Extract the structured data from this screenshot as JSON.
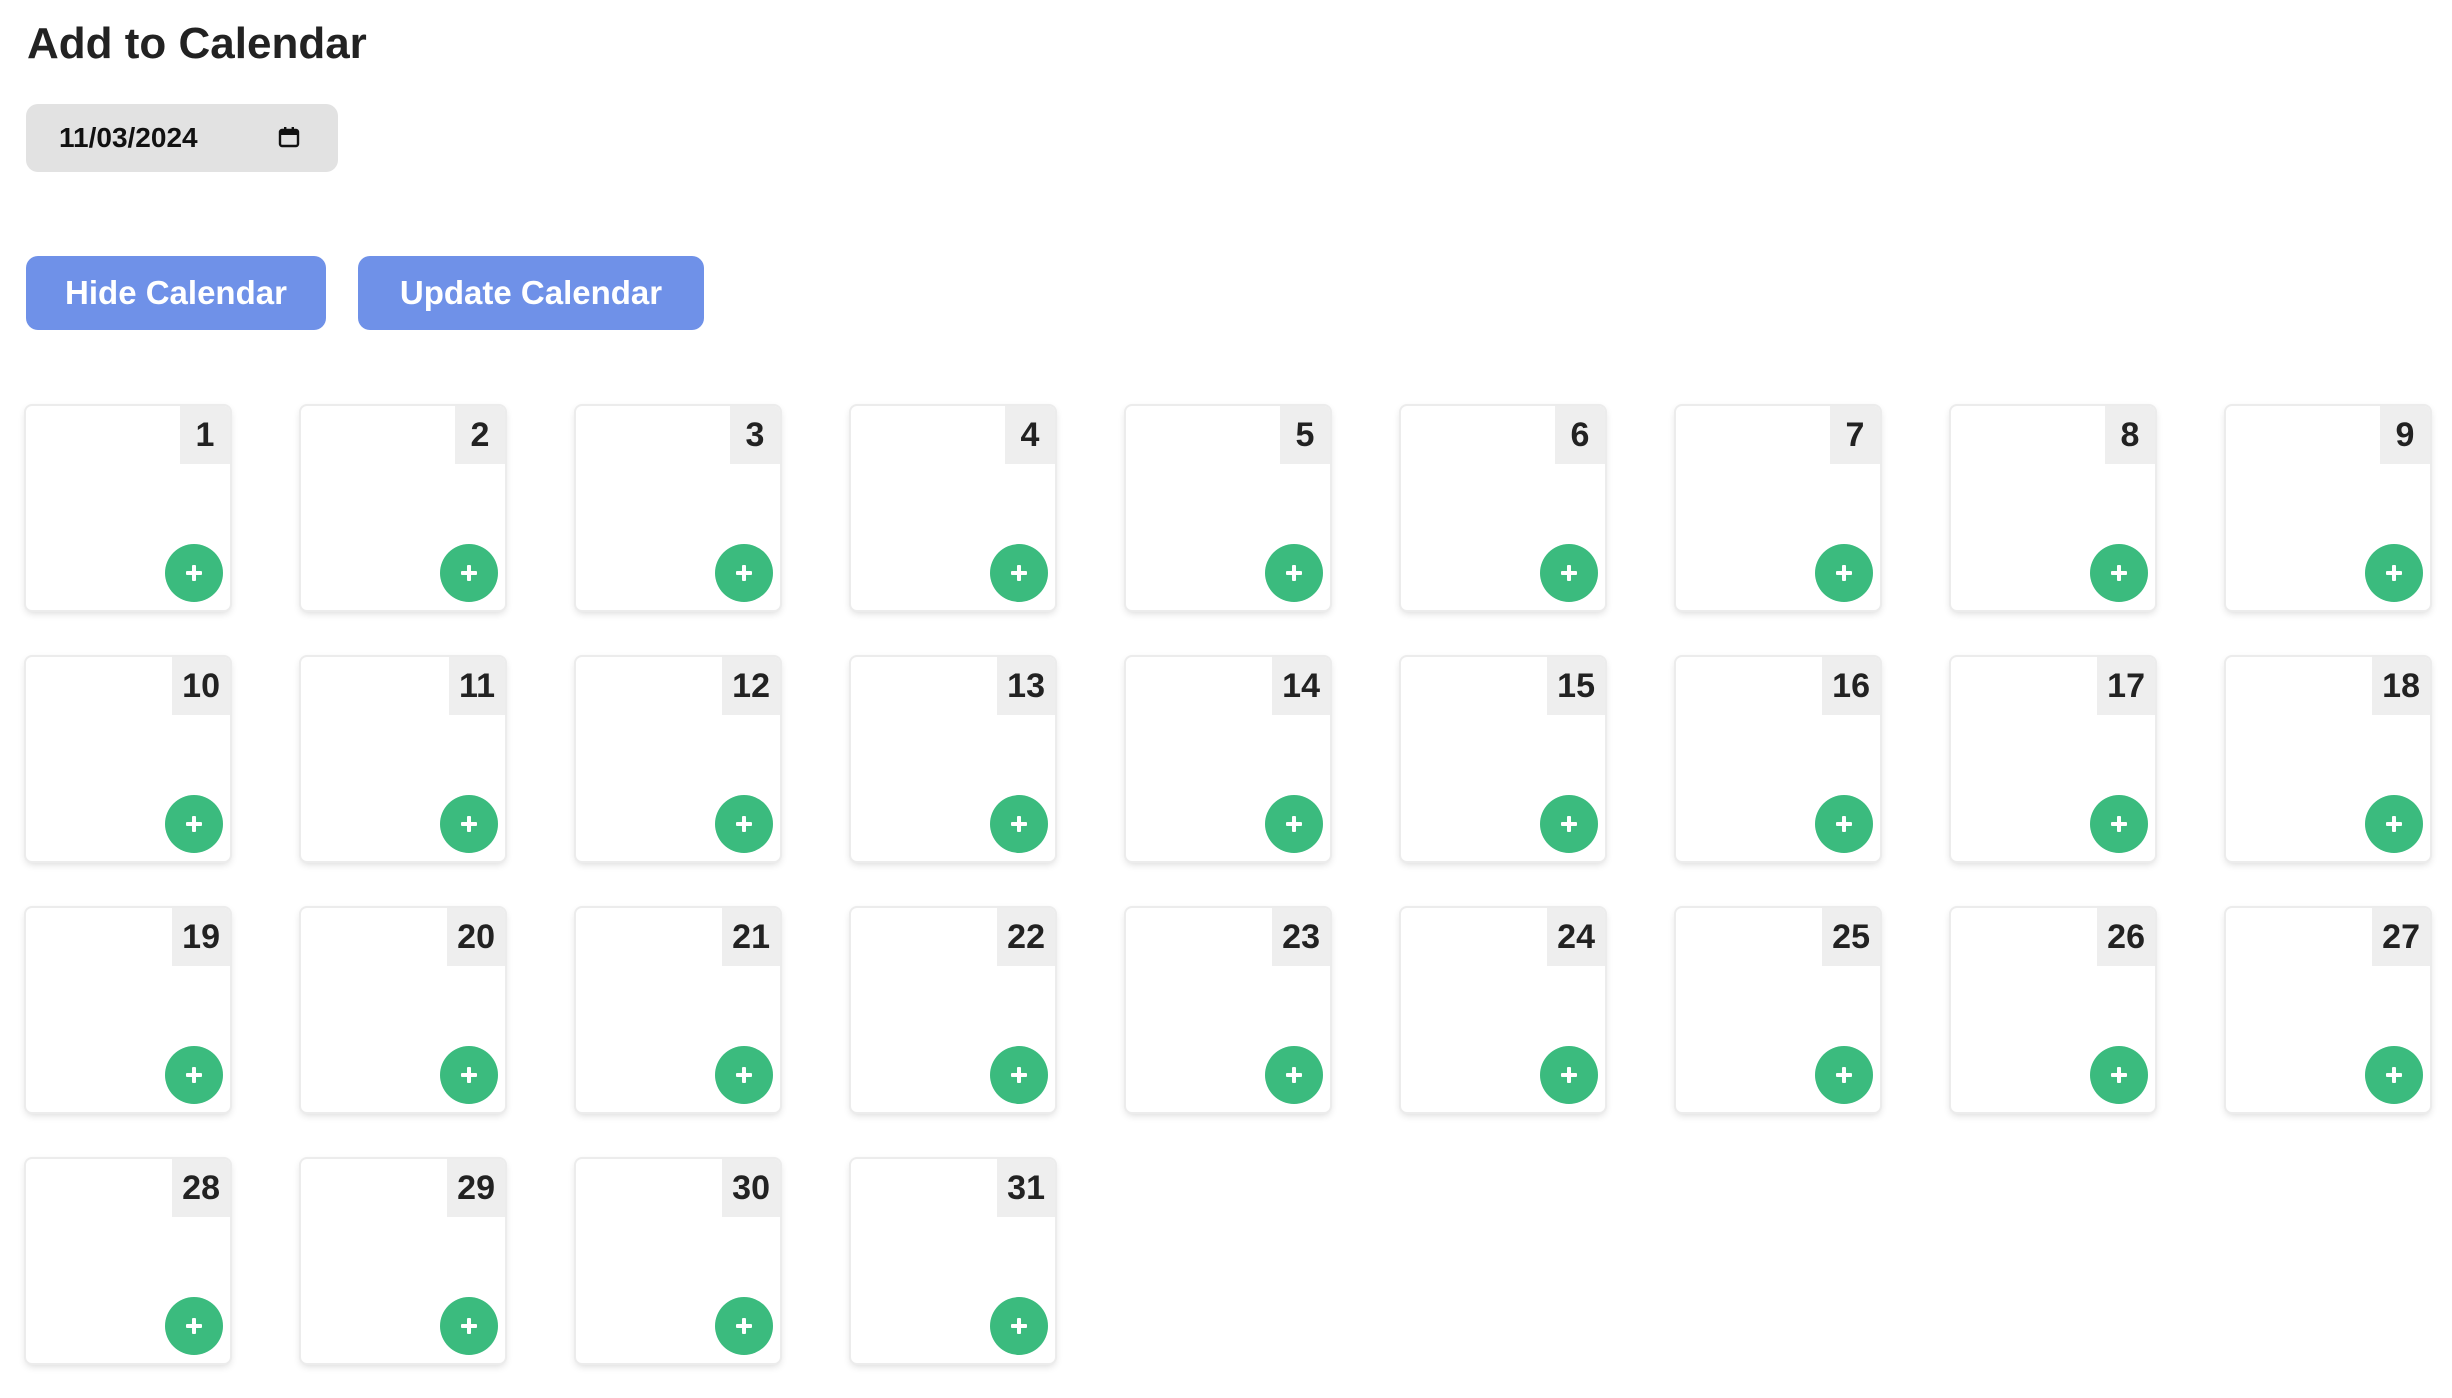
{
  "title": "Add to Calendar",
  "date_input": {
    "value": "11/03/2024",
    "icon": "calendar-icon"
  },
  "buttons": {
    "hide_label": "Hide Calendar",
    "update_label": "Update Calendar"
  },
  "days": [
    "1",
    "2",
    "3",
    "4",
    "5",
    "6",
    "7",
    "8",
    "9",
    "10",
    "11",
    "12",
    "13",
    "14",
    "15",
    "16",
    "17",
    "18",
    "19",
    "20",
    "21",
    "22",
    "23",
    "24",
    "25",
    "26",
    "27",
    "28",
    "29",
    "30",
    "31"
  ],
  "day_add_icon": "plus-icon",
  "colors": {
    "button_bg": "#6f91e8",
    "add_button_bg": "#3bbb7e",
    "day_number_bg": "#eeeeee",
    "date_input_bg": "#e2e2e2"
  }
}
